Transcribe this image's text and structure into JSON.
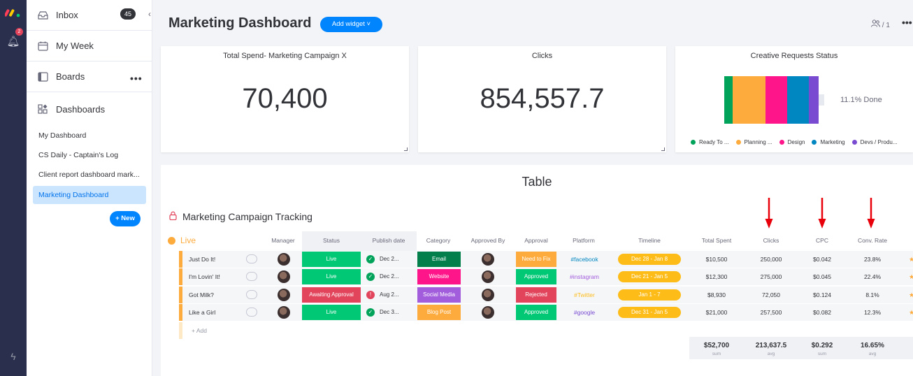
{
  "sidebar": {
    "inbox_label": "Inbox",
    "inbox_count": "45",
    "my_week_label": "My Week",
    "boards_label": "Boards",
    "dashboards_label": "Dashboards",
    "dashboards": [
      "My Dashboard",
      "CS Daily - Captain's Log",
      "Client report dashboard mark...",
      "Marketing Dashboard"
    ],
    "new_label": "+ New",
    "notification_count": "2"
  },
  "header": {
    "title": "Marketing Dashboard",
    "add_widget_label": "Add widget ˅",
    "viewer_count": "/ 1"
  },
  "widgets": {
    "spend": {
      "title": "Total Spend- Marketing Campaign X",
      "value": "70,400"
    },
    "clicks": {
      "title": "Clicks",
      "value": "854,557.7"
    },
    "creative": {
      "title": "Creative Requests Status",
      "done_text": "11.1% Done",
      "segments": [
        {
          "name": "Ready To ...",
          "color": "#00a359",
          "fraction": 0.09
        },
        {
          "name": "Planning ...",
          "color": "#fdab3d",
          "fraction": 0.35
        },
        {
          "name": "Design",
          "color": "#ff158a",
          "fraction": 0.23
        },
        {
          "name": "Marketing",
          "color": "#0086c0",
          "fraction": 0.23
        },
        {
          "name": "Devs / Produ...",
          "color": "#784bd1",
          "fraction": 0.1
        }
      ]
    }
  },
  "table": {
    "heading": "Table",
    "board_name": "Marketing Campaign Tracking",
    "group_name": "Live",
    "columns": [
      "Manager",
      "Status",
      "Publish date",
      "Category",
      "Approved By",
      "Approval",
      "Platform",
      "Timeline",
      "Total Spent",
      "Clicks",
      "CPC",
      "Conv. Rate"
    ],
    "rows": [
      {
        "name": "Just Do It!",
        "status": "Live",
        "status_color": "#00c875",
        "publish": "Dec 2...",
        "publish_icon": "✓",
        "publish_icon_color": "#00a359",
        "category": "Email",
        "category_color": "#037f4c",
        "approval": "Need to Fix",
        "approval_color": "#fdab3d",
        "platform": "#facebook",
        "platform_color": "#0086c0",
        "timeline": "Dec 28 - Jan 8",
        "spent": "$10,500",
        "clicks": "250,000",
        "cpc": "$0.042",
        "conv": "23.8%"
      },
      {
        "name": "I'm Lovin' It!",
        "status": "Live",
        "status_color": "#00c875",
        "publish": "Dec 2...",
        "publish_icon": "✓",
        "publish_icon_color": "#00a359",
        "category": "Website",
        "category_color": "#ff158a",
        "approval": "Approved",
        "approval_color": "#00c875",
        "platform": "#instagram",
        "platform_color": "#a25ddc",
        "timeline": "Dec 21 - Jan 5",
        "spent": "$12,300",
        "clicks": "275,000",
        "cpc": "$0.045",
        "conv": "22.4%"
      },
      {
        "name": "Got Milk?",
        "status": "Awaiting Approval",
        "status_color": "#e2445c",
        "publish": "Aug 2...",
        "publish_icon": "!",
        "publish_icon_color": "#e2445c",
        "category": "Social Media",
        "category_color": "#a25ddc",
        "approval": "Rejected",
        "approval_color": "#e2445c",
        "platform": "#Twitter",
        "platform_color": "#fdbc18",
        "timeline": "Jan 1 - 7",
        "spent": "$8,930",
        "clicks": "72,050",
        "cpc": "$0.124",
        "conv": "8.1%"
      },
      {
        "name": "Like a Girl",
        "status": "Live",
        "status_color": "#00c875",
        "publish": "Dec 3...",
        "publish_icon": "✓",
        "publish_icon_color": "#00a359",
        "category": "Blog Post",
        "category_color": "#fdab3d",
        "approval": "Approved",
        "approval_color": "#00c875",
        "platform": "#google",
        "platform_color": "#784bd1",
        "timeline": "Dec 31 - Jan 5",
        "spent": "$21,000",
        "clicks": "257,500",
        "cpc": "$0.082",
        "conv": "12.3%"
      }
    ],
    "add_label": "+ Add",
    "summary": [
      {
        "value": "$52,700",
        "label": "sum"
      },
      {
        "value": "213,637.5",
        "label": "avg"
      },
      {
        "value": "$0.292",
        "label": "sum"
      },
      {
        "value": "16.65%",
        "label": "avg"
      }
    ]
  },
  "colors": {
    "accent": "#0085ff",
    "rail": "#292f4c",
    "group": "#fdab3d",
    "arrow": "#e8000b"
  }
}
